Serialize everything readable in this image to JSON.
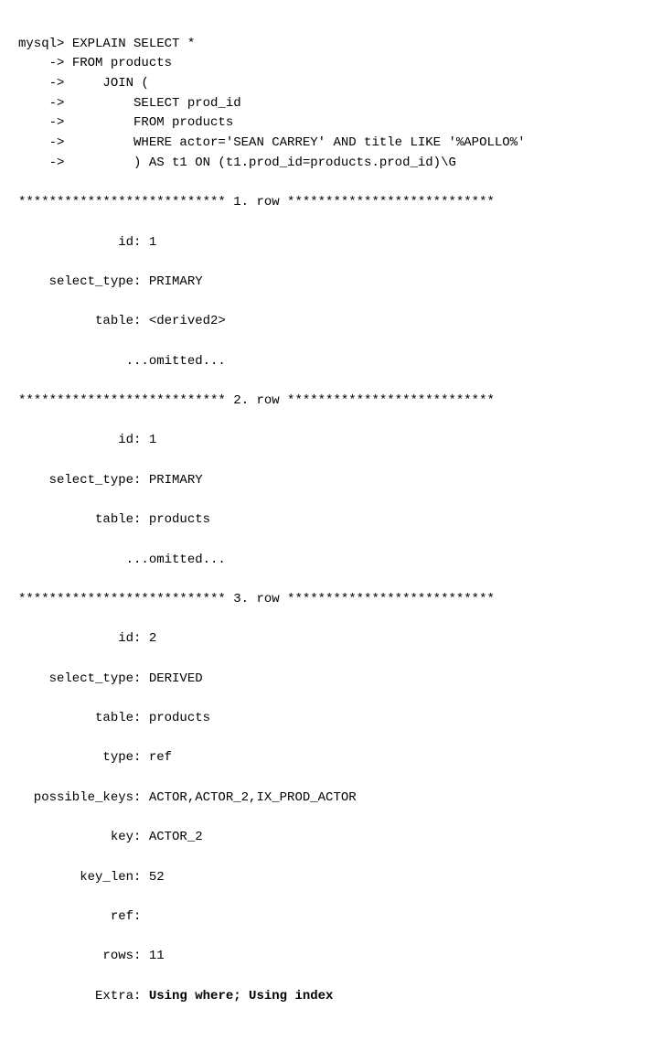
{
  "terminal": {
    "prompt": "mysql>",
    "arrow": "->",
    "command": {
      "line1": "EXPLAIN SELECT *",
      "line2": "FROM products",
      "line3": "JOIN (",
      "line4": "SELECT prod_id",
      "line5": "FROM products",
      "line6": "WHERE actor='SEAN CARREY' AND title LIKE '%APOLLO%'",
      "line7": ") AS t1 ON (t1.prod_id=products.prod_id)\\G"
    },
    "separator": "*************************** {n}. row ***************************",
    "rows": [
      {
        "n": "1",
        "id": "1",
        "select_type": "PRIMARY",
        "table": "<derived2>",
        "omitted": "...omitted..."
      },
      {
        "n": "2",
        "id": "1",
        "select_type": "PRIMARY",
        "table": "products",
        "omitted": "...omitted..."
      },
      {
        "n": "3",
        "id": "2",
        "select_type": "DERIVED",
        "table": "products",
        "type": "ref",
        "possible_keys": "ACTOR,ACTOR_2,IX_PROD_ACTOR",
        "key": "ACTOR_2",
        "key_len": "52",
        "ref": "",
        "rows": "11",
        "extra": "Using where; Using index"
      }
    ],
    "labels": {
      "id": "id:",
      "select_type": "select_type:",
      "table": "table:",
      "omitted": "...omitted...",
      "type": "type:",
      "possible_keys": "possible_keys:",
      "key": "key:",
      "key_len": "key_len:",
      "ref": "ref:",
      "rows": "rows:",
      "extra": "Extra:"
    }
  }
}
